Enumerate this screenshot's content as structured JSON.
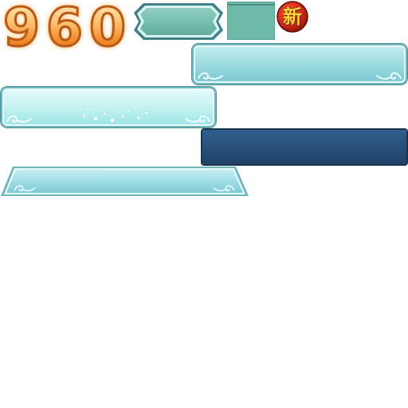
{
  "digits": [
    "9",
    "6",
    "0"
  ],
  "badge": {
    "label": "新",
    "color": "#d42a1a"
  },
  "colors": {
    "digit_fill": "#f6a24a",
    "digit_outline": "#b85a1a",
    "panel_light": "#bfecef",
    "panel_border": "#6fb7bf",
    "swatch": "#6eb8a8",
    "dark_bar": "#28527c"
  },
  "icons": [
    "swirl-ornament-icon",
    "sparkle-icon"
  ]
}
